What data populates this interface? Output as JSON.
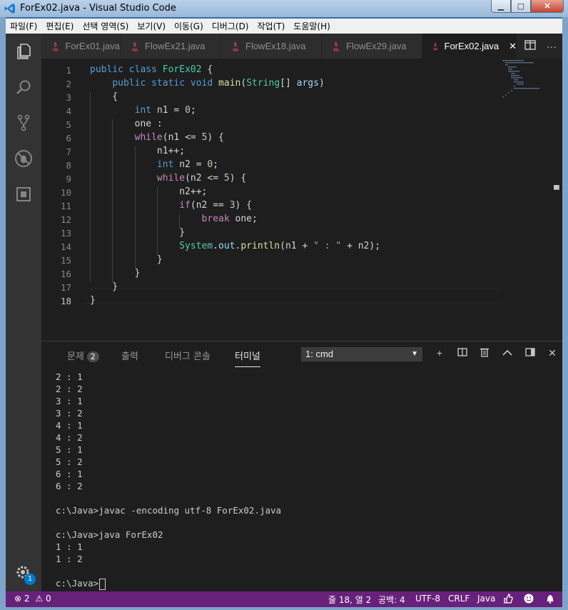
{
  "window": {
    "title": "ForEx02.java - Visual Studio Code"
  },
  "menu": [
    "파일(F)",
    "편집(E)",
    "선택 영역(S)",
    "보기(V)",
    "이동(G)",
    "디버그(D)",
    "작업(T)",
    "도움말(H)"
  ],
  "tabs": [
    {
      "label": "ForEx01.java",
      "active": false
    },
    {
      "label": "FlowEx21.java",
      "active": false
    },
    {
      "label": "FlowEx18.java",
      "active": false
    },
    {
      "label": "FlowEx29.java",
      "active": false
    },
    {
      "label": "ForEx02.java",
      "active": true
    }
  ],
  "tab_close": "✕",
  "editor": {
    "line_numbers": [
      "1",
      "2",
      "3",
      "4",
      "5",
      "6",
      "7",
      "8",
      "9",
      "10",
      "11",
      "12",
      "13",
      "14",
      "15",
      "16",
      "17",
      "18"
    ],
    "current_line": 18,
    "code": [
      "public class ForEx02 {",
      "    public static void main(String[] args)",
      "    {",
      "        int n1 = 0;",
      "        one :",
      "        while(n1 <= 5) {",
      "            n1++;",
      "            int n2 = 0;",
      "            while(n2 <= 5) {",
      "                n2++;",
      "                if(n2 == 3) {",
      "                    break one;",
      "                }",
      "                System.out.println(n1 + \" : \" + n2);",
      "            }",
      "        }",
      "    }",
      "}"
    ]
  },
  "panel": {
    "tabs": {
      "problems": "문제",
      "problems_count": "2",
      "output": "출력",
      "debug_console": "디버그 콘솔",
      "terminal": "터미널"
    },
    "terminal_select": "1: cmd",
    "terminal_lines": [
      "2 : 1",
      "2 : 2",
      "3 : 1",
      "3 : 2",
      "4 : 1",
      "4 : 2",
      "5 : 1",
      "5 : 2",
      "6 : 1",
      "6 : 2",
      "",
      "c:\\Java>javac -encoding utf-8 ForEx02.java",
      "",
      "c:\\Java>java ForEx02",
      "1 : 1",
      "1 : 2",
      ""
    ],
    "prompt": "c:\\Java>"
  },
  "activity_badge": "1",
  "statusbar": {
    "errors": "2",
    "warnings": "0",
    "position": "줄 18, 열 2",
    "indent": "공백: 4",
    "encoding": "UTF-8",
    "eol": "CRLF",
    "language": "Java"
  },
  "colors": {
    "statusbar": "#68217a",
    "editor_bg": "#1e1e1e",
    "activity_bg": "#333333"
  }
}
